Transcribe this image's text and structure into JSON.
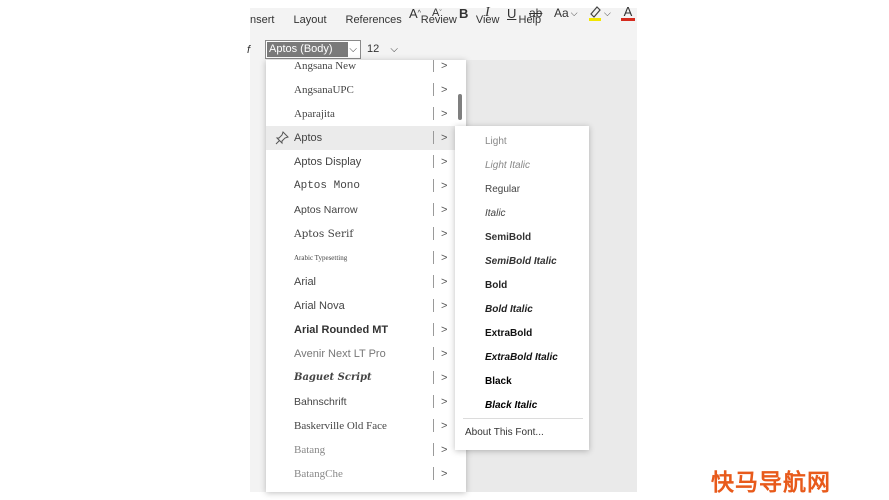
{
  "menu": [
    "nsert",
    "Layout",
    "References",
    "Review",
    "View",
    "Help"
  ],
  "toolbar": {
    "font_name": "Aptos (Body)",
    "font_size": "12",
    "grow_label": "A",
    "shrink_label": "A",
    "bold_label": "B",
    "italic_label": "I",
    "underline_label": "U",
    "strike_label": "ab",
    "case_label": "Aa",
    "highlight_label": "ab",
    "fontcolor_label": "A",
    "highlight_color": "#f2e600",
    "fontcolor_color": "#d52b1e"
  },
  "fonts": [
    {
      "name": "Angsana New"
    },
    {
      "name": "AngsanaUPC"
    },
    {
      "name": "Aparajita"
    },
    {
      "name": "Aptos"
    },
    {
      "name": "Aptos Display"
    },
    {
      "name": "Aptos Mono"
    },
    {
      "name": "Aptos Narrow"
    },
    {
      "name": "Aptos Serif"
    },
    {
      "name": "Arabic Typesetting"
    },
    {
      "name": "Arial"
    },
    {
      "name": "Arial Nova"
    },
    {
      "name": "Arial Rounded MT"
    },
    {
      "name": "Avenir Next LT Pro"
    },
    {
      "name": "Baguet Script"
    },
    {
      "name": "Bahnschrift"
    },
    {
      "name": "Baskerville Old Face"
    },
    {
      "name": "Batang"
    },
    {
      "name": "BatangChe"
    }
  ],
  "styles": [
    "Light",
    "Light Italic",
    "Regular",
    "Italic",
    "SemiBold",
    "SemiBold Italic",
    "Bold",
    "Bold Italic",
    "ExtraBold",
    "ExtraBold Italic",
    "Black",
    "Black Italic"
  ],
  "about": "About This Font...",
  "watermark": "快马导航网"
}
